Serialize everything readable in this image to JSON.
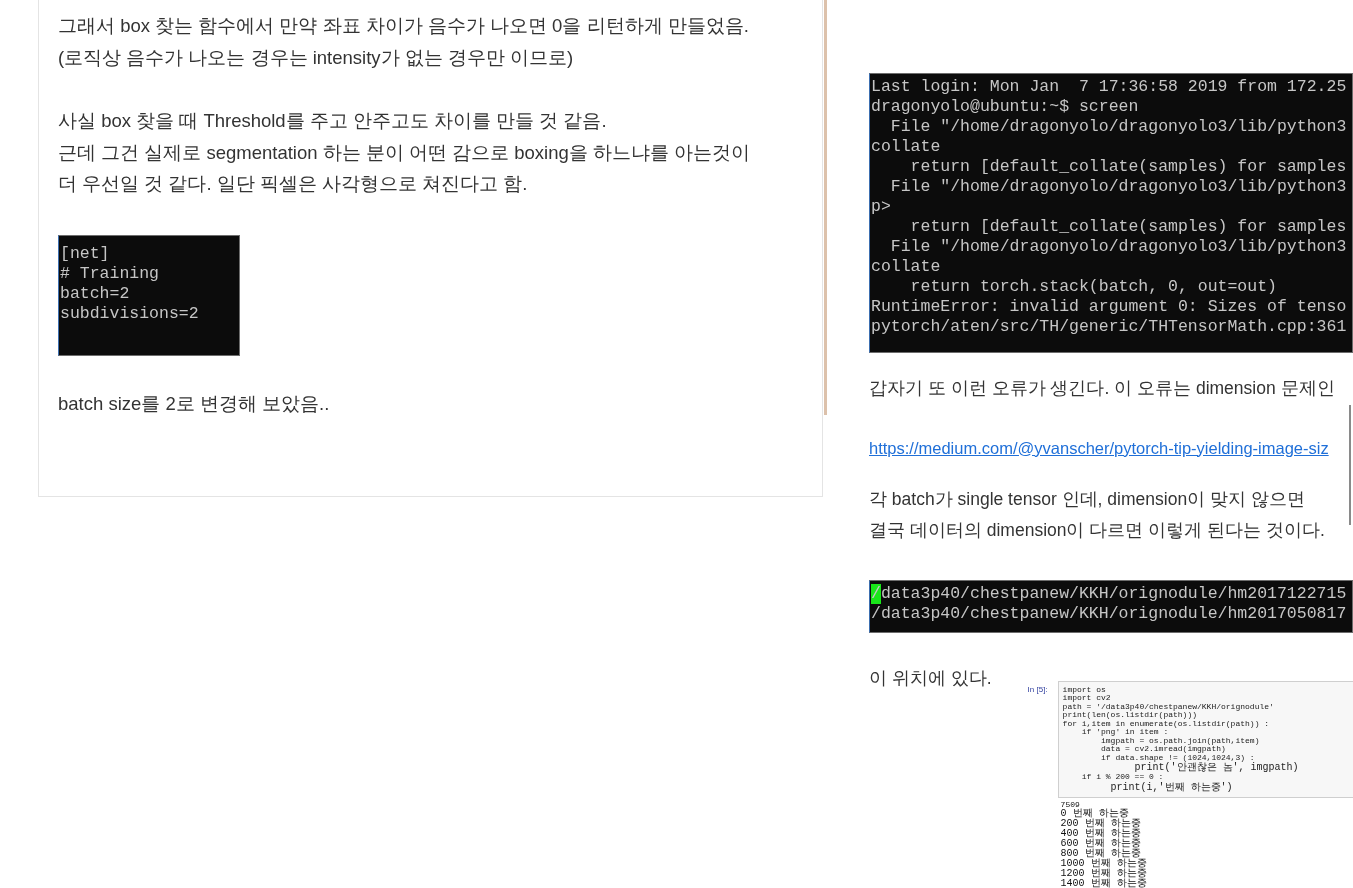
{
  "left_post": {
    "blocks": [
      {
        "kind": "text",
        "lines": [
          "그래서 box 찾는 함수에서 만약 좌표 차이가 음수가 나오면 0을 리턴하게 만들었음.",
          "(로직상 음수가 나오는 경우는 intensity가 없는 경우만 이므로)"
        ]
      },
      {
        "kind": "text",
        "lines": [
          "사실 box 찾을 때 Threshold를 주고 안주고도 차이를 만들 것 같음.",
          "근데 그건 실제로 segmentation 하는 분이 어떤 감으로 boxing을 하느냐를 아는것이",
          "더 우선일 것 같다. 일단 픽셀은 사각형으로 쳐진다고 함."
        ]
      },
      {
        "kind": "terminal",
        "cursor": false,
        "lines": [
          "[net]",
          "# Training",
          "batch=2",
          "subdivisions=2"
        ]
      },
      {
        "kind": "text",
        "lines": [
          "batch size를 2로 변경해 보았음.."
        ]
      }
    ]
  },
  "right_post": {
    "blocks": [
      {
        "kind": "terminal",
        "cursor": false,
        "lines": [
          "Last login: Mon Jan  7 17:36:58 2019 from 172.25",
          "dragonyolo@ubuntu:~$ screen",
          "  File \"/home/dragonyolo/dragonyolo3/lib/python3",
          "collate",
          "    return [default_collate(samples) for samples",
          "  File \"/home/dragonyolo/dragonyolo3/lib/python3",
          "p>",
          "    return [default_collate(samples) for samples",
          "  File \"/home/dragonyolo/dragonyolo3/lib/python3",
          "collate",
          "    return torch.stack(batch, 0, out=out)",
          "RuntimeError: invalid argument 0: Sizes of tenso",
          "pytorch/aten/src/TH/generic/THTensorMath.cpp:361"
        ]
      },
      {
        "kind": "text",
        "lines": [
          "갑자기 또 이런 오류가 생긴다. 이 오류는 dimension 문제인"
        ]
      },
      {
        "kind": "link",
        "text": "https://medium.com/@yvanscher/pytorch-tip-yielding-image-siz"
      },
      {
        "kind": "text",
        "lines": [
          "각 batch가 single tensor 인데, dimension이 맞지 않으면",
          "결국 데이터의 dimension이 다르면 이렇게 된다는 것이다."
        ]
      },
      {
        "kind": "terminal",
        "cursor": true,
        "lines": [
          "/data3p40/chestpanew/KKH/orignodule/hm2017122715",
          "/data3p40/chestpanew/KKH/orignodule/hm2017050817"
        ]
      },
      {
        "kind": "notebook",
        "caption": "이 위치에 있다.",
        "prompt": "In [5]:",
        "code": [
          "import os",
          "import cv2",
          "path = '/data3p40/chestpanew/KKH/orignodule'",
          "print(len(os.listdir(path)))",
          "for i,item in enumerate(os.listdir(path)) :",
          "    if 'png' in item :",
          "        imgpath = os.path.join(path,item)",
          "        data = cv2.imread(imgpath)",
          "        if data.shape != (1024,1024,3) :",
          "            print('안괜찮은 놈', imgpath)",
          "    if i % 200 == 0 :",
          "        print(i,'번째 하는중')"
        ],
        "output": [
          "7509",
          "0 번째 하는중",
          "200 번째 하는중",
          "400 번째 하는중",
          "600 번째 하는중",
          "800 번째 하는중",
          "1000 번째 하는중",
          "1200 번째 하는중",
          "1400 번째 하는중"
        ]
      }
    ]
  }
}
